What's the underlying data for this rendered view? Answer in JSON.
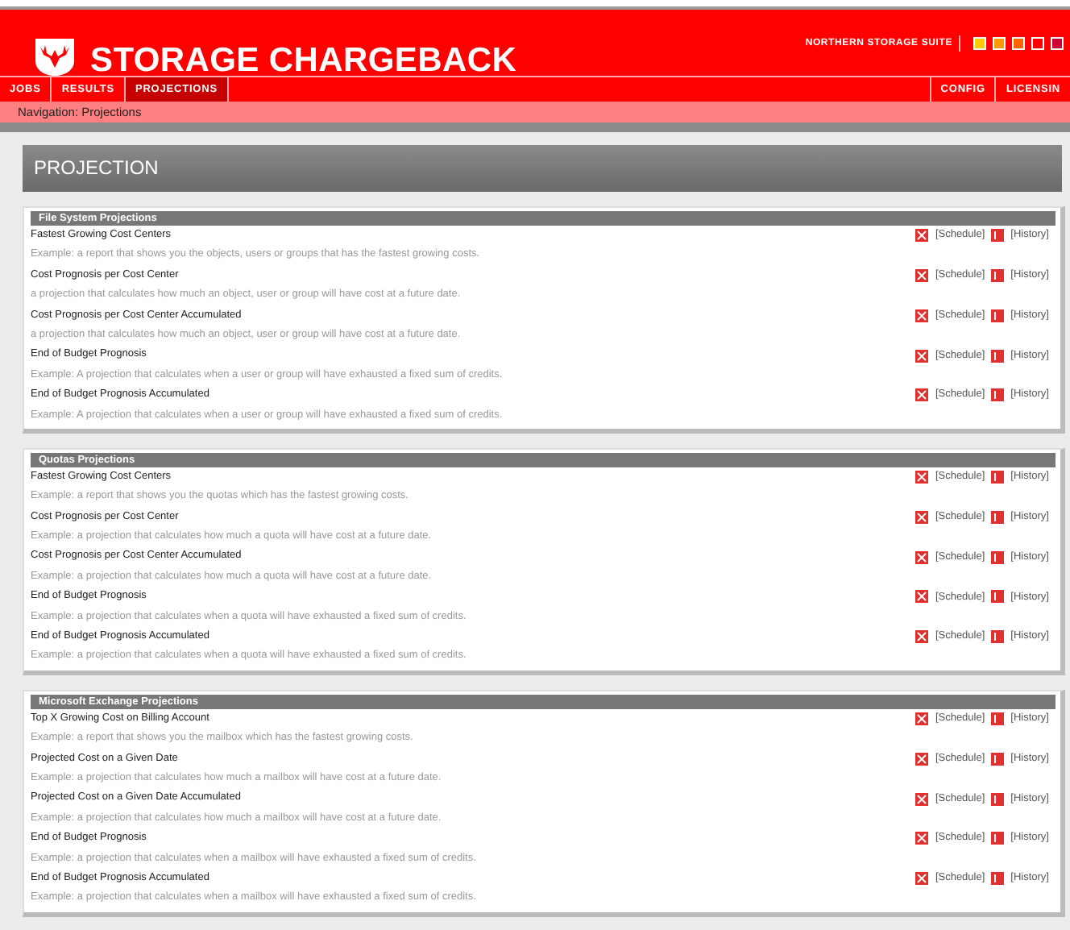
{
  "app": {
    "title": "STORAGE CHARGEBACK",
    "suite": "NORTHERN STORAGE SUITE",
    "theme_swatches": [
      {
        "color": "#ffcc00"
      },
      {
        "color": "#ff9900"
      },
      {
        "color": "#ff6600"
      },
      {
        "color": "#ff0000"
      },
      {
        "color": "#cc0033"
      }
    ]
  },
  "tabs_left": [
    {
      "label": "JOBS",
      "selected": false
    },
    {
      "label": "RESULTS",
      "selected": false
    },
    {
      "label": "PROJECTIONS",
      "selected": true
    }
  ],
  "tabs_right": [
    {
      "label": "CONFIG",
      "selected": false
    },
    {
      "label": "LICENSIN",
      "selected": false
    }
  ],
  "breadcrumb": "Navigation: Projections",
  "page_title": "PROJECTION",
  "sections": [
    {
      "title": "File System Projections",
      "items": [
        {
          "name": "Fastest Growing Cost Centers",
          "description": "Example: a report that shows you the objects, users or groups that has the fastest growing costs.",
          "schedule": "[Schedule]",
          "history": "[History]"
        },
        {
          "name": "Cost Prognosis per Cost Center",
          "description": "a projection that calculates how much an object, user or group will have cost at a future date.",
          "schedule": "[Schedule]",
          "history": "[History]"
        },
        {
          "name": "Cost Prognosis per Cost Center Accumulated",
          "description": "a projection that calculates how much an object, user or group will have cost at a future date.",
          "schedule": "[Schedule]",
          "history": "[History]"
        },
        {
          "name": "End of Budget Prognosis",
          "description": "Example: A projection that calculates when a user or group will have exhausted a fixed sum of credits.",
          "schedule": "[Schedule]",
          "history": "[History]"
        },
        {
          "name": "End of Budget Prognosis Accumulated",
          "description": "Example: A projection that calculates when a user or group will have exhausted a fixed sum of credits.",
          "schedule": "[Schedule]",
          "history": "[History]"
        }
      ]
    },
    {
      "title": "Quotas Projections",
      "items": [
        {
          "name": "Fastest Growing Cost Centers",
          "description": "Example: a report that shows you the quotas which has the fastest growing costs.",
          "schedule": "[Schedule]",
          "history": "[History]"
        },
        {
          "name": "Cost Prognosis per Cost Center",
          "description": "Example: a projection that calculates how much a quota will have cost at a future date.",
          "schedule": "[Schedule]",
          "history": "[History]"
        },
        {
          "name": "Cost Prognosis per Cost Center Accumulated",
          "description": "Example: a projection that calculates how much a quota will have cost at a future date.",
          "schedule": "[Schedule]",
          "history": "[History]"
        },
        {
          "name": "End of Budget Prognosis",
          "description": "Example: a projection that calculates when a quota will have exhausted a fixed sum of credits.",
          "schedule": "[Schedule]",
          "history": "[History]"
        },
        {
          "name": "End of Budget Prognosis Accumulated",
          "description": "Example: a projection that calculates when a quota will have exhausted a fixed sum of credits.",
          "schedule": "[Schedule]",
          "history": "[History]"
        }
      ]
    },
    {
      "title": "Microsoft Exchange Projections",
      "items": [
        {
          "name": "Top X Growing Cost on Billing Account",
          "description": "Example: a report that shows you the mailbox which has the fastest growing costs.",
          "schedule": "[Schedule]",
          "history": "[History]"
        },
        {
          "name": "Projected Cost on a Given Date",
          "description": "Example: a projection that calculates how much a mailbox will have cost at a future date.",
          "schedule": "[Schedule]",
          "history": "[History]"
        },
        {
          "name": "Projected Cost on a Given Date Accumulated",
          "description": "Example: a projection that calculates how much a mailbox will have cost at a future date.",
          "schedule": "[Schedule]",
          "history": "[History]"
        },
        {
          "name": "End of Budget Prognosis",
          "description": "Example: a projection that calculates when a mailbox will have exhausted a fixed sum of credits.",
          "schedule": "[Schedule]",
          "history": "[History]"
        },
        {
          "name": "End of Budget Prognosis Accumulated",
          "description": "Example: a projection that calculates when a mailbox will have exhausted a fixed sum of credits.",
          "schedule": "[Schedule]",
          "history": "[History]"
        }
      ]
    }
  ]
}
